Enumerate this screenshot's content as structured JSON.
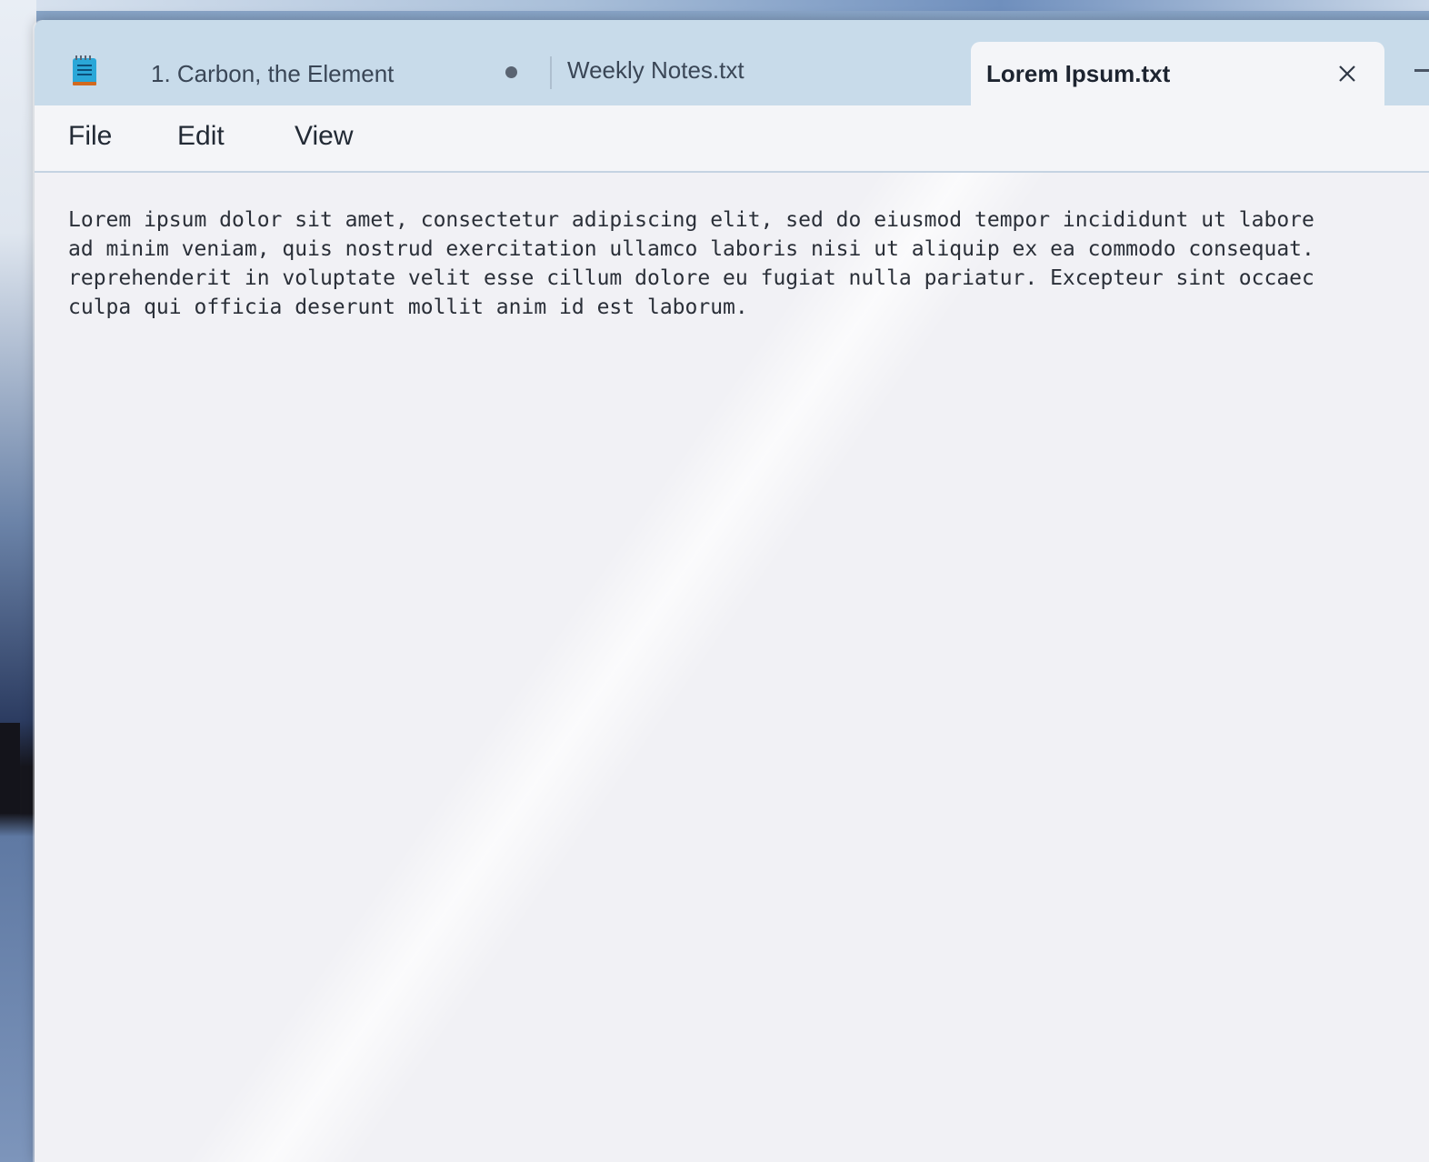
{
  "window": {
    "tabs": [
      {
        "label": "1. Carbon, the Element",
        "modified": true
      },
      {
        "label": "Weekly Notes.txt",
        "modified": false
      },
      {
        "label": "Lorem Ipsum.txt",
        "active": true
      }
    ]
  },
  "menu": {
    "file": "File",
    "edit": "Edit",
    "view": "View"
  },
  "editor": {
    "lines": [
      "Lorem ipsum dolor sit amet, consectetur adipiscing elit, sed do eiusmod tempor incididunt ut labore",
      "ad minim veniam, quis nostrud exercitation ullamco laboris nisi ut aliquip ex ea commodo consequat.",
      "reprehenderit in voluptate velit esse cillum dolore eu fugiat nulla pariatur. Excepteur sint occaec",
      "culpa qui officia deserunt mollit anim id est laborum."
    ]
  },
  "icons": {
    "app": "notepad-icon",
    "modified": "unsaved-dot-icon",
    "close": "close-icon"
  },
  "colors": {
    "tabbar": "#c8dbea",
    "active_tab": "#f4f5f8",
    "editor_bg": "#f1f1f5"
  }
}
